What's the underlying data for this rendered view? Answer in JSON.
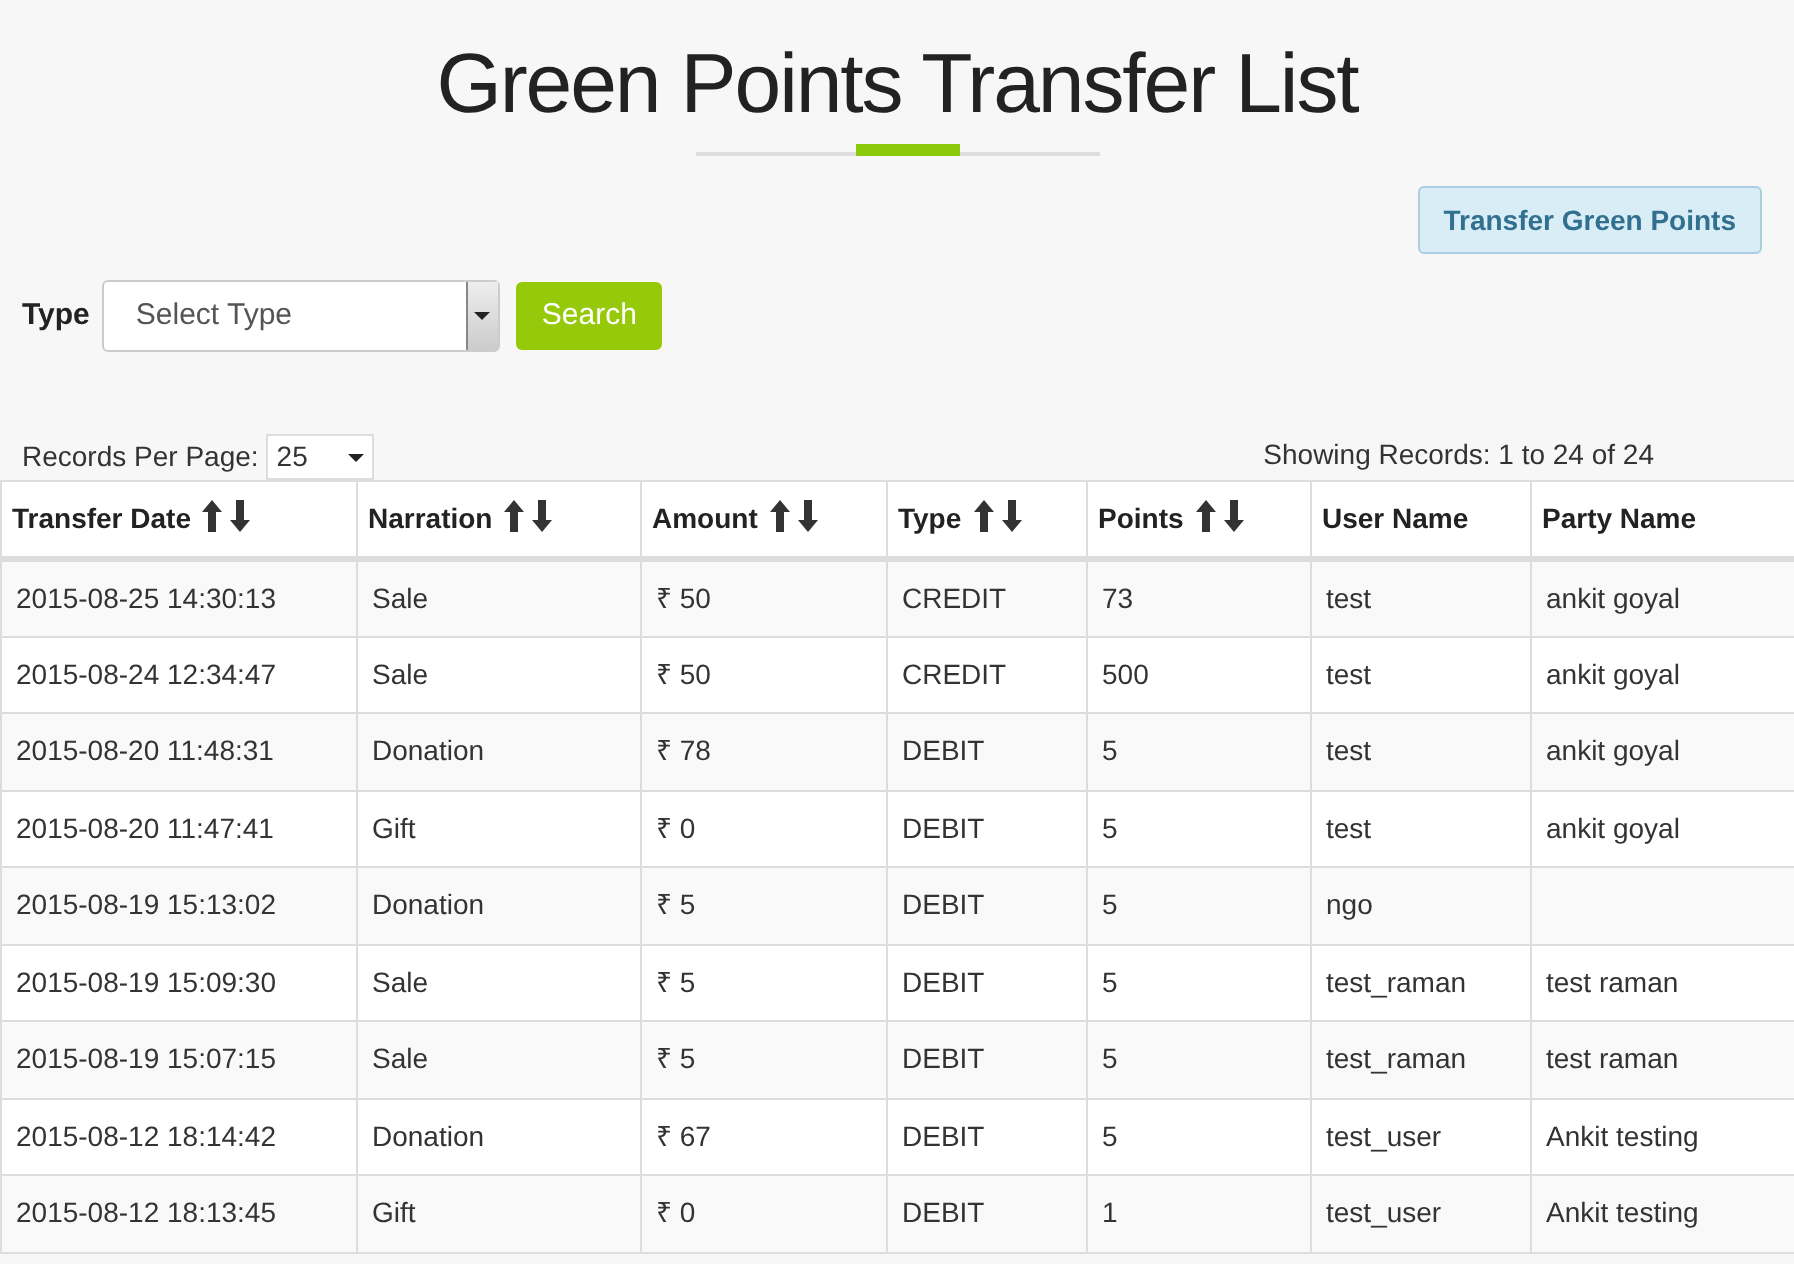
{
  "title": "Green Points Transfer List",
  "transfer_button": "Transfer Green Points",
  "filter": {
    "label": "Type",
    "placeholder": "Select Type",
    "search_button": "Search"
  },
  "records_per_page": {
    "label": "Records Per Page:",
    "value": "25"
  },
  "showing": "Showing Records: 1 to 24 of 24",
  "table": {
    "columns": [
      {
        "label": "Transfer Date",
        "sortable": true
      },
      {
        "label": "Narration",
        "sortable": true
      },
      {
        "label": "Amount",
        "sortable": true
      },
      {
        "label": "Type",
        "sortable": true
      },
      {
        "label": "Points",
        "sortable": true
      },
      {
        "label": "User Name",
        "sortable": false
      },
      {
        "label": "Party Name",
        "sortable": false
      }
    ],
    "rows": [
      [
        "2015-08-25 14:30:13",
        "Sale",
        "₹ 50",
        "CREDIT",
        "73",
        "test",
        "ankit goyal"
      ],
      [
        "2015-08-24 12:34:47",
        "Sale",
        "₹ 50",
        "CREDIT",
        "500",
        "test",
        "ankit goyal"
      ],
      [
        "2015-08-20 11:48:31",
        "Donation",
        "₹ 78",
        "DEBIT",
        "5",
        "test",
        "ankit goyal"
      ],
      [
        "2015-08-20 11:47:41",
        "Gift",
        "₹ 0",
        "DEBIT",
        "5",
        "test",
        "ankit goyal"
      ],
      [
        "2015-08-19 15:13:02",
        "Donation",
        "₹ 5",
        "DEBIT",
        "5",
        "ngo",
        null
      ],
      [
        "2015-08-19 15:09:30",
        "Sale",
        "₹ 5",
        "DEBIT",
        "5",
        "test_raman",
        "test raman"
      ],
      [
        "2015-08-19 15:07:15",
        "Sale",
        "₹ 5",
        "DEBIT",
        "5",
        "test_raman",
        "test raman"
      ],
      [
        "2015-08-12 18:14:42",
        "Donation",
        "₹ 67",
        "DEBIT",
        "5",
        "test_user",
        "Ankit testing"
      ],
      [
        "2015-08-12 18:13:45",
        "Gift",
        "₹ 0",
        "DEBIT",
        "1",
        "test_user",
        "Ankit testing"
      ]
    ]
  }
}
